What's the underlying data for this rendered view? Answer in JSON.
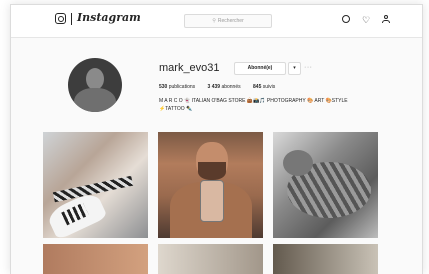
{
  "header": {
    "wordmark": "Instagram",
    "search_placeholder": "Rechercher",
    "icons": [
      "instagram-glyph-icon",
      "search-icon",
      "compass-icon",
      "heart-icon",
      "person-icon"
    ]
  },
  "profile": {
    "username": "mark_evo31",
    "follow_label": "Abonné(e)",
    "dropdown_label": "▾",
    "more_label": "···",
    "stats": {
      "posts_count": "530",
      "posts_label": "publications",
      "followers_count": "3 439",
      "followers_label": "abonnés",
      "following_count": "845",
      "following_label": "suivis"
    },
    "bio_line1": "M A R C O 👻 ITALIAN O'BAG STORE 👜📸🎵 PHOTOGRAPHY 🎨 ART 🎨STYLE",
    "bio_line2": "⚡TATTOO ✒️"
  },
  "posts": [
    {
      "description_icon": "bracelet-photo"
    },
    {
      "description_icon": "selfie-photo"
    },
    {
      "description_icon": "cat-photo"
    },
    {
      "description_icon": "photo"
    },
    {
      "description_icon": "photo"
    },
    {
      "description_icon": "photo"
    }
  ]
}
